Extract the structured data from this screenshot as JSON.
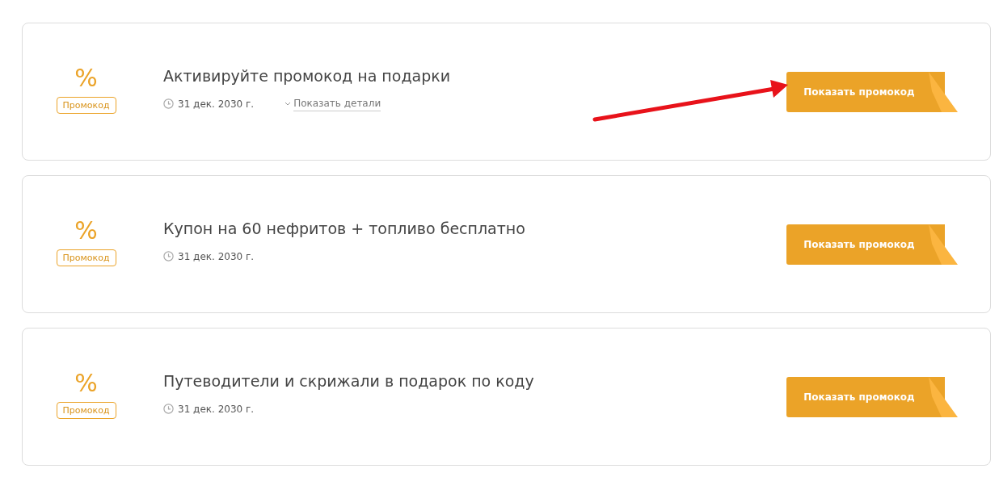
{
  "offers": [
    {
      "icon": "%",
      "badge": "Промокод",
      "title": "Активируйте промокод на подарки",
      "date": "31 дек. 2030 г.",
      "details_link": "Показать детали",
      "button": "Показать промокод",
      "arrow_pointing": true
    },
    {
      "icon": "%",
      "badge": "Промокод",
      "title": "Купон на 60 нефритов + топливо бесплатно",
      "date": "31 дек. 2030 г.",
      "button": "Показать промокод",
      "arrow_pointing": false
    },
    {
      "icon": "%",
      "badge": "Промокод",
      "title": "Путеводители и скрижали в подарок по коду",
      "date": "31 дек. 2030 г.",
      "button": "Показать промокод",
      "arrow_pointing": false
    }
  ]
}
